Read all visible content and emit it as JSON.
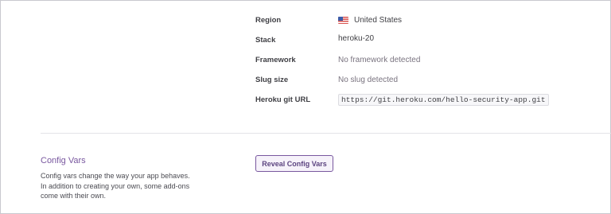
{
  "settings": {
    "rows": [
      {
        "label": "Region",
        "value": "United States",
        "flag": "us-flag-icon"
      },
      {
        "label": "Stack",
        "value": "heroku-20"
      },
      {
        "label": "Framework",
        "value": "No framework detected"
      },
      {
        "label": "Slug size",
        "value": "No slug detected"
      },
      {
        "label": "Heroku git URL",
        "value": "https://git.heroku.com/hello-security-app.git"
      }
    ]
  },
  "config_vars": {
    "title": "Config Vars",
    "description": "Config vars change the way your app behaves. In addition to creating your own, some add-ons come with their own.",
    "reveal_label": "Reveal Config Vars"
  },
  "colors": {
    "accent": "#79589f",
    "text": "#3f3f44",
    "muted": "#79737f"
  }
}
